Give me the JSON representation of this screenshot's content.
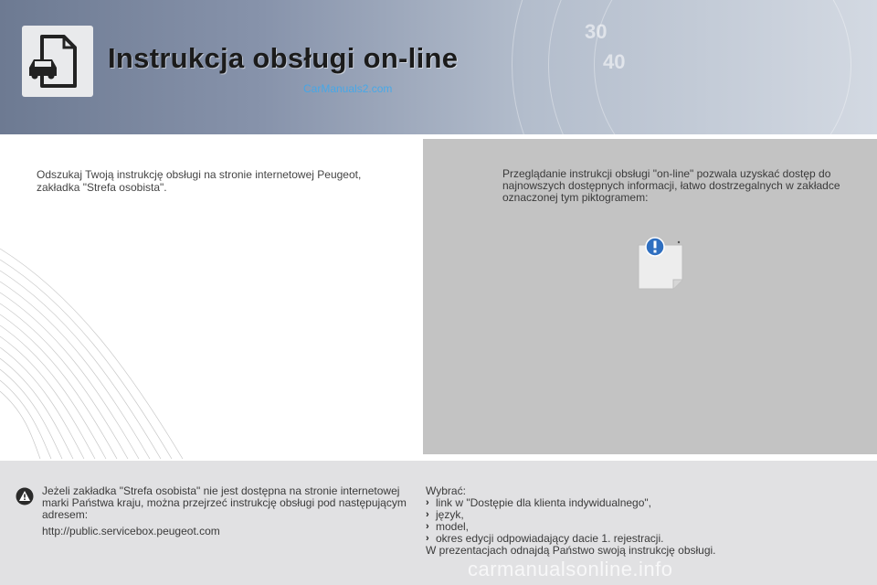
{
  "header": {
    "title": "Instrukcja obsługi on-line",
    "watermark": "CarManuals2.com",
    "dial_numbers": [
      "30",
      "40"
    ],
    "icon": "car-document-icon"
  },
  "left": {
    "text": "Odszukaj Twoją instrukcję obsługi na stronie internetowej Peugeot, zakładka \"Strefa osobista\"."
  },
  "right_panel": {
    "text": "Przeglądanie instrukcji obsługi \"on-line\" pozwala uzyskać dostęp do najnowszych dostępnych informacji, łatwo dostrzegalnych w zakładce oznaczonej tym piktogramem:",
    "pictogram": "info-document-icon",
    "background": "#c3c3c3"
  },
  "bottom": {
    "warning_icon": "warning-icon",
    "note": "Jeżeli zakładka \"Strefa osobista\" nie jest dostępna na stronie internetowej marki Państwa kraju, można przejrzeć instrukcję obsługi pod następującym adresem:",
    "url": "http://public.servicebox.peugeot.com",
    "choose_label": "Wybrać:",
    "items": [
      "link w \"Dostępie dla klienta indywidualnego\",",
      "język,",
      "model,",
      "okres edycji odpowiadający dacie 1. rejestracji."
    ],
    "footer": "W prezentacjach odnajdą Państwo swoją instrukcję obsługi.",
    "watermark": "carmanualsonline.info"
  }
}
